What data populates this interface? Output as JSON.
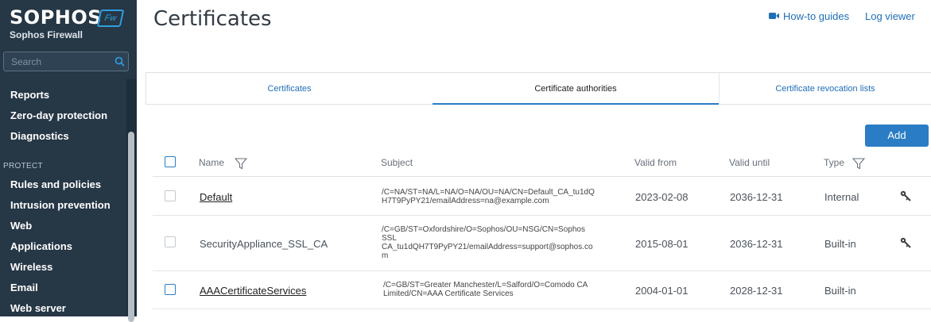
{
  "brand": {
    "logo": "SOPHOS",
    "badge": "Fw",
    "product": "Sophos Firewall"
  },
  "search": {
    "placeholder": "Search"
  },
  "sidebar": {
    "items_top": [
      "Reports",
      "Zero-day protection",
      "Diagnostics"
    ],
    "section_protect": "PROTECT",
    "items_protect": [
      "Rules and policies",
      "Intrusion prevention",
      "Web",
      "Applications",
      "Wireless",
      "Email",
      "Web server"
    ]
  },
  "header": {
    "title": "Certificates",
    "howto": "How-to guides",
    "logviewer": "Log viewer"
  },
  "tabs": [
    {
      "label": "Certificates",
      "active": false
    },
    {
      "label": "Certificate authorities",
      "active": true
    },
    {
      "label": "Certificate revocation lists",
      "active": false
    }
  ],
  "toolbar": {
    "add_label": "Add"
  },
  "table": {
    "columns": {
      "name": "Name",
      "subject": "Subject",
      "valid_from": "Valid from",
      "valid_until": "Valid until",
      "type": "Type"
    },
    "rows": [
      {
        "name": "Default",
        "subject": [
          "/C=NA/ST=NA/L=NA/O=NA/OU=NA/CN=Default_CA_tu1dQ",
          "H7T9PyPY21/emailAddress=na@example.com"
        ],
        "valid_from": "2023-02-08",
        "valid_until": "2036-12-31",
        "type": "Internal"
      },
      {
        "name": "SecurityAppliance_SSL_CA",
        "subject": [
          "/C=GB/ST=Oxfordshire/O=Sophos/OU=NSG/CN=Sophos",
          "SSL",
          "CA_tu1dQH7T9PyPY21/emailAddress=support@sophos.co",
          "m"
        ],
        "valid_from": "2015-08-01",
        "valid_until": "2036-12-31",
        "type": "Built-in"
      },
      {
        "name": "AAACertificateServices",
        "subject": [
          "/C=GB/ST=Greater Manchester/L=Salford/O=Comodo CA",
          "Limited/CN=AAA Certificate Services"
        ],
        "valid_from": "2004-01-01",
        "valid_until": "2028-12-31",
        "type": "Built-in"
      }
    ]
  },
  "colors": {
    "sidebar": "#263746",
    "accent": "#2a7dc4",
    "link": "#1f6fb5"
  }
}
